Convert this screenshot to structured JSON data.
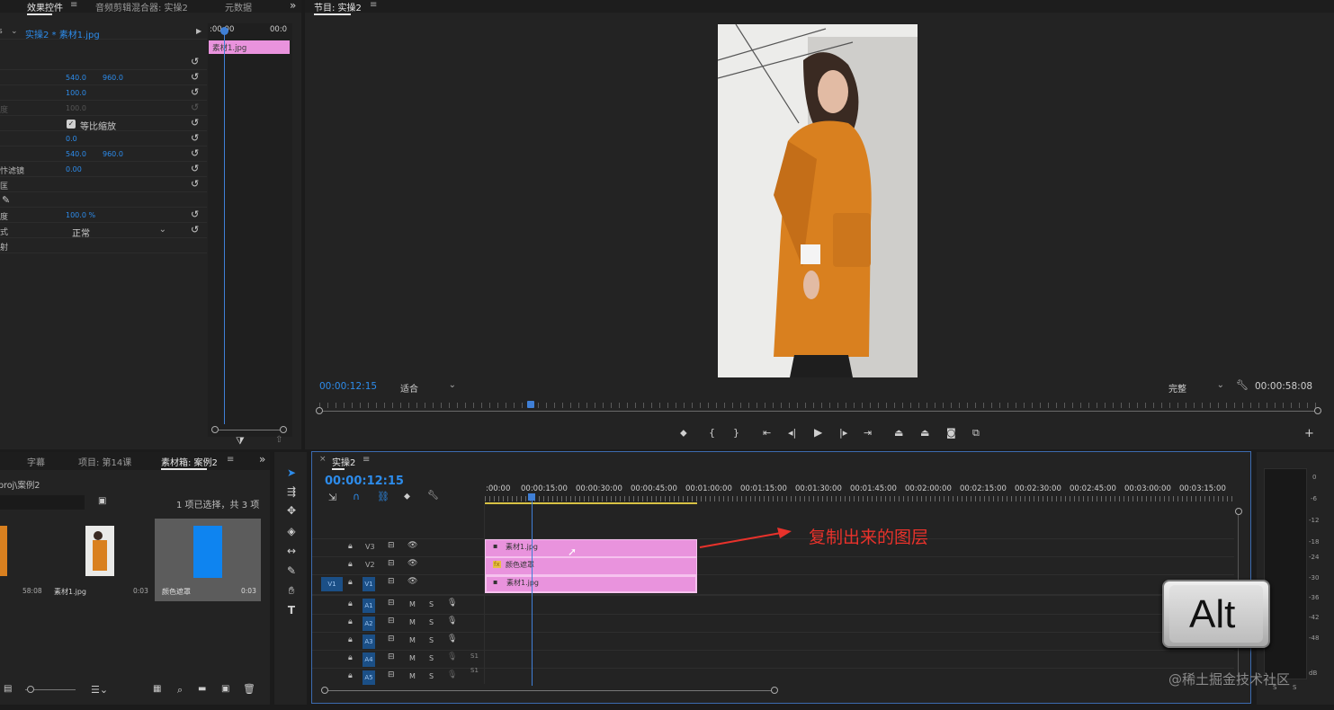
{
  "effect_controls": {
    "tabs": [
      "效果控件",
      "音频剪辑混合器: 实操2",
      "元数据"
    ],
    "clip_path": "实操2 * 素材1.jpg",
    "timecode_start": ":00:00",
    "timecode_end": "00:0",
    "clip_name": "素材1.jpg",
    "rows": [
      {
        "label": "",
        "v1": "",
        "v2": ""
      },
      {
        "label": "",
        "v1": "540.0",
        "v2": "960.0"
      },
      {
        "label": "",
        "v1": "100.0",
        "v2": ""
      },
      {
        "label": "度",
        "v1": "100.0",
        "v2": ""
      },
      {
        "label": "",
        "v1": "等比缩放",
        "v2": ""
      },
      {
        "label": "",
        "v1": "0.0",
        "v2": ""
      },
      {
        "label": "",
        "v1": "540.0",
        "v2": "960.0"
      },
      {
        "label": "忭滤镜",
        "v1": "0.00",
        "v2": ""
      },
      {
        "label": "",
        "v1": "",
        "v2": ""
      },
      {
        "label": "",
        "v1": "",
        "v2": ""
      },
      {
        "label": "度",
        "v1": "100.0 %",
        "v2": ""
      },
      {
        "label": "式",
        "v1": "正常",
        "v2": ""
      },
      {
        "label": "射",
        "v1": "",
        "v2": ""
      }
    ]
  },
  "program_monitor": {
    "title": "节目: 实操2",
    "timecode_current": "00:00:12:15",
    "fit_label": "适合",
    "quality_label": "完整",
    "duration": "00:00:58:08",
    "playhead": 0.225
  },
  "project": {
    "tabs": [
      "字幕",
      "项目: 第14课",
      "素材箱: 案例2"
    ],
    "path": "proj\\案例2",
    "selection_info": "1 项已选择，共 3 项",
    "items": [
      {
        "name": "",
        "duration": "58:08"
      },
      {
        "name": "素材1.jpg",
        "duration": "0:03"
      },
      {
        "name": "颜色遮罩",
        "duration": "0:03"
      }
    ]
  },
  "timeline": {
    "title": "实操2",
    "timecode": "00:00:12:15",
    "ruler": [
      ":00:00",
      "00:00:15:00",
      "00:00:30:00",
      "00:00:45:00",
      "00:01:00:00",
      "00:01:15:00",
      "00:01:30:00",
      "00:01:45:00",
      "00:02:00:00",
      "00:02:15:00",
      "00:02:30:00",
      "00:02:45:00",
      "00:03:00:00",
      "00:03:15:00"
    ],
    "video_tracks": [
      {
        "id": "V3",
        "clip": "素材1.jpg"
      },
      {
        "id": "V2",
        "clip": "颜色遮罩"
      },
      {
        "id": "V1",
        "clip": "素材1.jpg"
      }
    ],
    "source_patch": "V1",
    "audio_tracks": [
      {
        "id": "A1",
        "m": "M",
        "s": "S",
        "extra": ""
      },
      {
        "id": "A2",
        "m": "M",
        "s": "S",
        "extra": ""
      },
      {
        "id": "A3",
        "m": "M",
        "s": "S",
        "extra": ""
      },
      {
        "id": "A4",
        "m": "M",
        "s": "S",
        "extra": "S1"
      },
      {
        "id": "A5",
        "m": "M",
        "s": "S",
        "extra": "S1"
      }
    ]
  },
  "annotation": {
    "text": "复制出来的图层",
    "color": "#e8322b"
  },
  "meter": {
    "labels": [
      "0",
      "-6",
      "-12",
      "-18",
      "-24",
      "-30",
      "-36",
      "-42",
      "-48",
      "dB"
    ],
    "bottom": [
      "S",
      "S"
    ]
  },
  "key_overlay": "Alt",
  "watermark": "@稀土掘金技术社区",
  "colors": {
    "accent": "#2d8ceb",
    "clip": "#e993dd",
    "panel": "#232323"
  }
}
